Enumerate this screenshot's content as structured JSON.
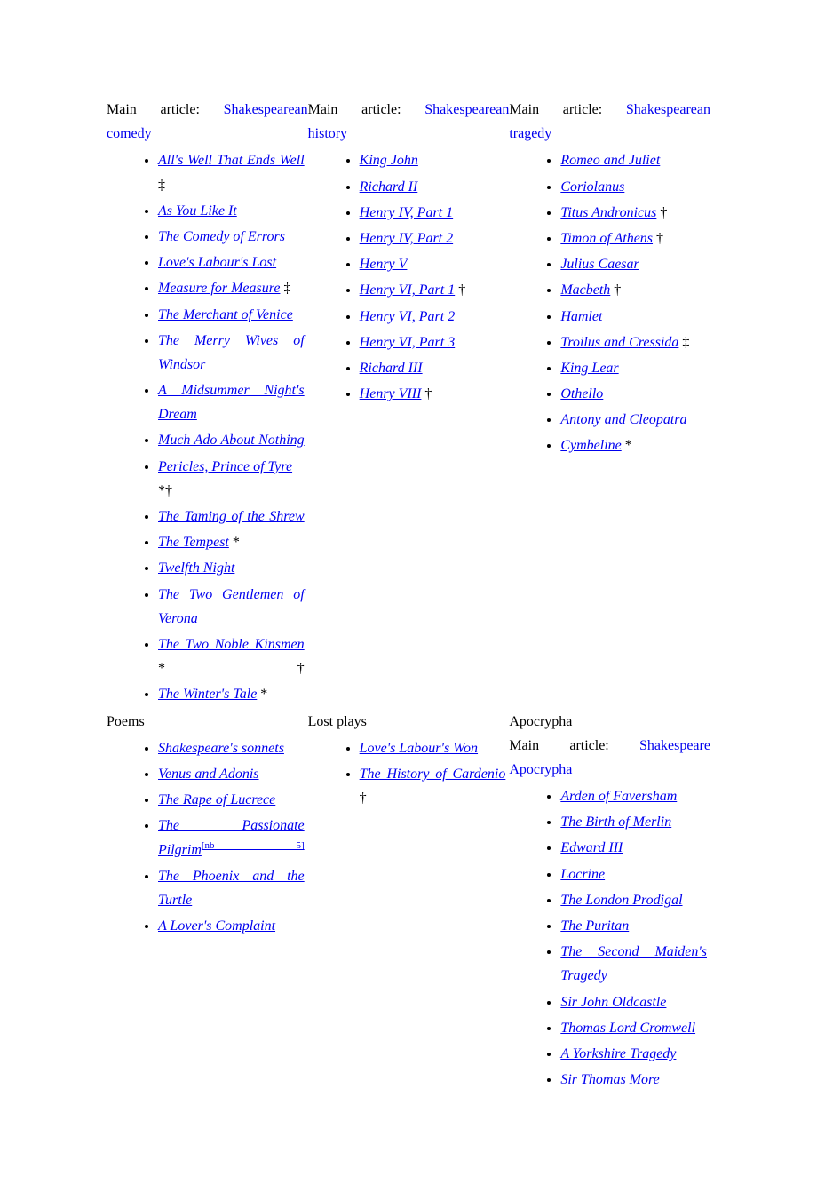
{
  "top": {
    "comedy": {
      "prefix": "Main article: ",
      "link": "Shakespearean comedy",
      "items": [
        {
          "t": "All's Well That Ends Well",
          "suffix": " ‡",
          "wrap": true
        },
        {
          "t": "As You Like It"
        },
        {
          "t": "The Comedy of Errors"
        },
        {
          "t": "Love's Labour's Lost"
        },
        {
          "t": "Measure for Measure",
          "suffix": " ‡"
        },
        {
          "t": "The Merchant of Venice"
        },
        {
          "t": "The Merry Wives of Windsor",
          "wrap": true
        },
        {
          "t": "A Midsummer Night's Dream",
          "wrap": true
        },
        {
          "t": "Much Ado About Nothing",
          "wrap": true
        },
        {
          "t": "Pericles, Prince of Tyre",
          "suffix": " *†"
        },
        {
          "t": "The Taming of the Shrew",
          "wrap": true
        },
        {
          "t": "The Tempest",
          "suffix": " *"
        },
        {
          "t": "Twelfth Night"
        },
        {
          "t": "The Two Gentlemen of Verona",
          "wrap": true
        },
        {
          "t": "The Two Noble Kinsmen",
          "suffix": " *†",
          "wrap": true
        },
        {
          "t": "The Winter's Tale",
          "suffix": " *"
        }
      ]
    },
    "history": {
      "prefix": "Main article: ",
      "link": "Shakespearean history",
      "items": [
        {
          "t": "King John"
        },
        {
          "t": "Richard II"
        },
        {
          "t": "Henry IV, Part 1"
        },
        {
          "t": "Henry IV, Part 2"
        },
        {
          "t": "Henry V"
        },
        {
          "t": "Henry VI, Part 1",
          "suffix": " †"
        },
        {
          "t": "Henry VI, Part 2"
        },
        {
          "t": "Henry VI, Part 3"
        },
        {
          "t": "Richard III"
        },
        {
          "t": "Henry VIII",
          "suffix": " †"
        }
      ]
    },
    "tragedy": {
      "prefix": "Main article: ",
      "link": "Shakespearean tragedy",
      "items": [
        {
          "t": "Romeo and Juliet"
        },
        {
          "t": "Coriolanus"
        },
        {
          "t": "Titus Andronicus",
          "suffix": " †"
        },
        {
          "t": "Timon of Athens",
          "suffix": " †"
        },
        {
          "t": "Julius Caesar"
        },
        {
          "t": "Macbeth",
          "suffix": " †"
        },
        {
          "t": "Hamlet"
        },
        {
          "t": "Troilus and Cressida",
          "suffix": " ‡"
        },
        {
          "t": "King Lear"
        },
        {
          "t": "Othello"
        },
        {
          "t": "Antony and Cleopatra"
        },
        {
          "t": "Cymbeline",
          "suffix": " *"
        }
      ]
    }
  },
  "bottom": {
    "poems": {
      "title": "Poems",
      "items": [
        {
          "t": "Shakespeare's sonnets"
        },
        {
          "t": "Venus and Adonis"
        },
        {
          "t": "The Rape of Lucrece"
        },
        {
          "t": "The Passionate Pilgrim",
          "wrap": true,
          "sup": "[nb 5]"
        },
        {
          "t": "The Phoenix and the Turtle",
          "wrap": true
        },
        {
          "t": "A Lover's Complaint"
        }
      ]
    },
    "lost": {
      "title": "Lost plays",
      "items": [
        {
          "t": "Love's Labour's Won"
        },
        {
          "t": "The History of Cardenio",
          "suffix": " †",
          "wrap": true
        }
      ]
    },
    "apocrypha": {
      "title": "Apocrypha",
      "prefix": "Main article: ",
      "link": "Shakespeare Apocrypha",
      "items": [
        {
          "t": "Arden of Faversham"
        },
        {
          "t": "The Birth of Merlin"
        },
        {
          "t": "Edward III"
        },
        {
          "t": "Locrine"
        },
        {
          "t": "The London Prodigal"
        },
        {
          "t": "The Puritan"
        },
        {
          "t": "The Second Maiden's Tragedy",
          "wrap": true
        },
        {
          "t": "Sir John Oldcastle"
        },
        {
          "t": "Thomas Lord Cromwell"
        },
        {
          "t": "A Yorkshire Tragedy"
        },
        {
          "t": "Sir Thomas More"
        }
      ]
    }
  }
}
